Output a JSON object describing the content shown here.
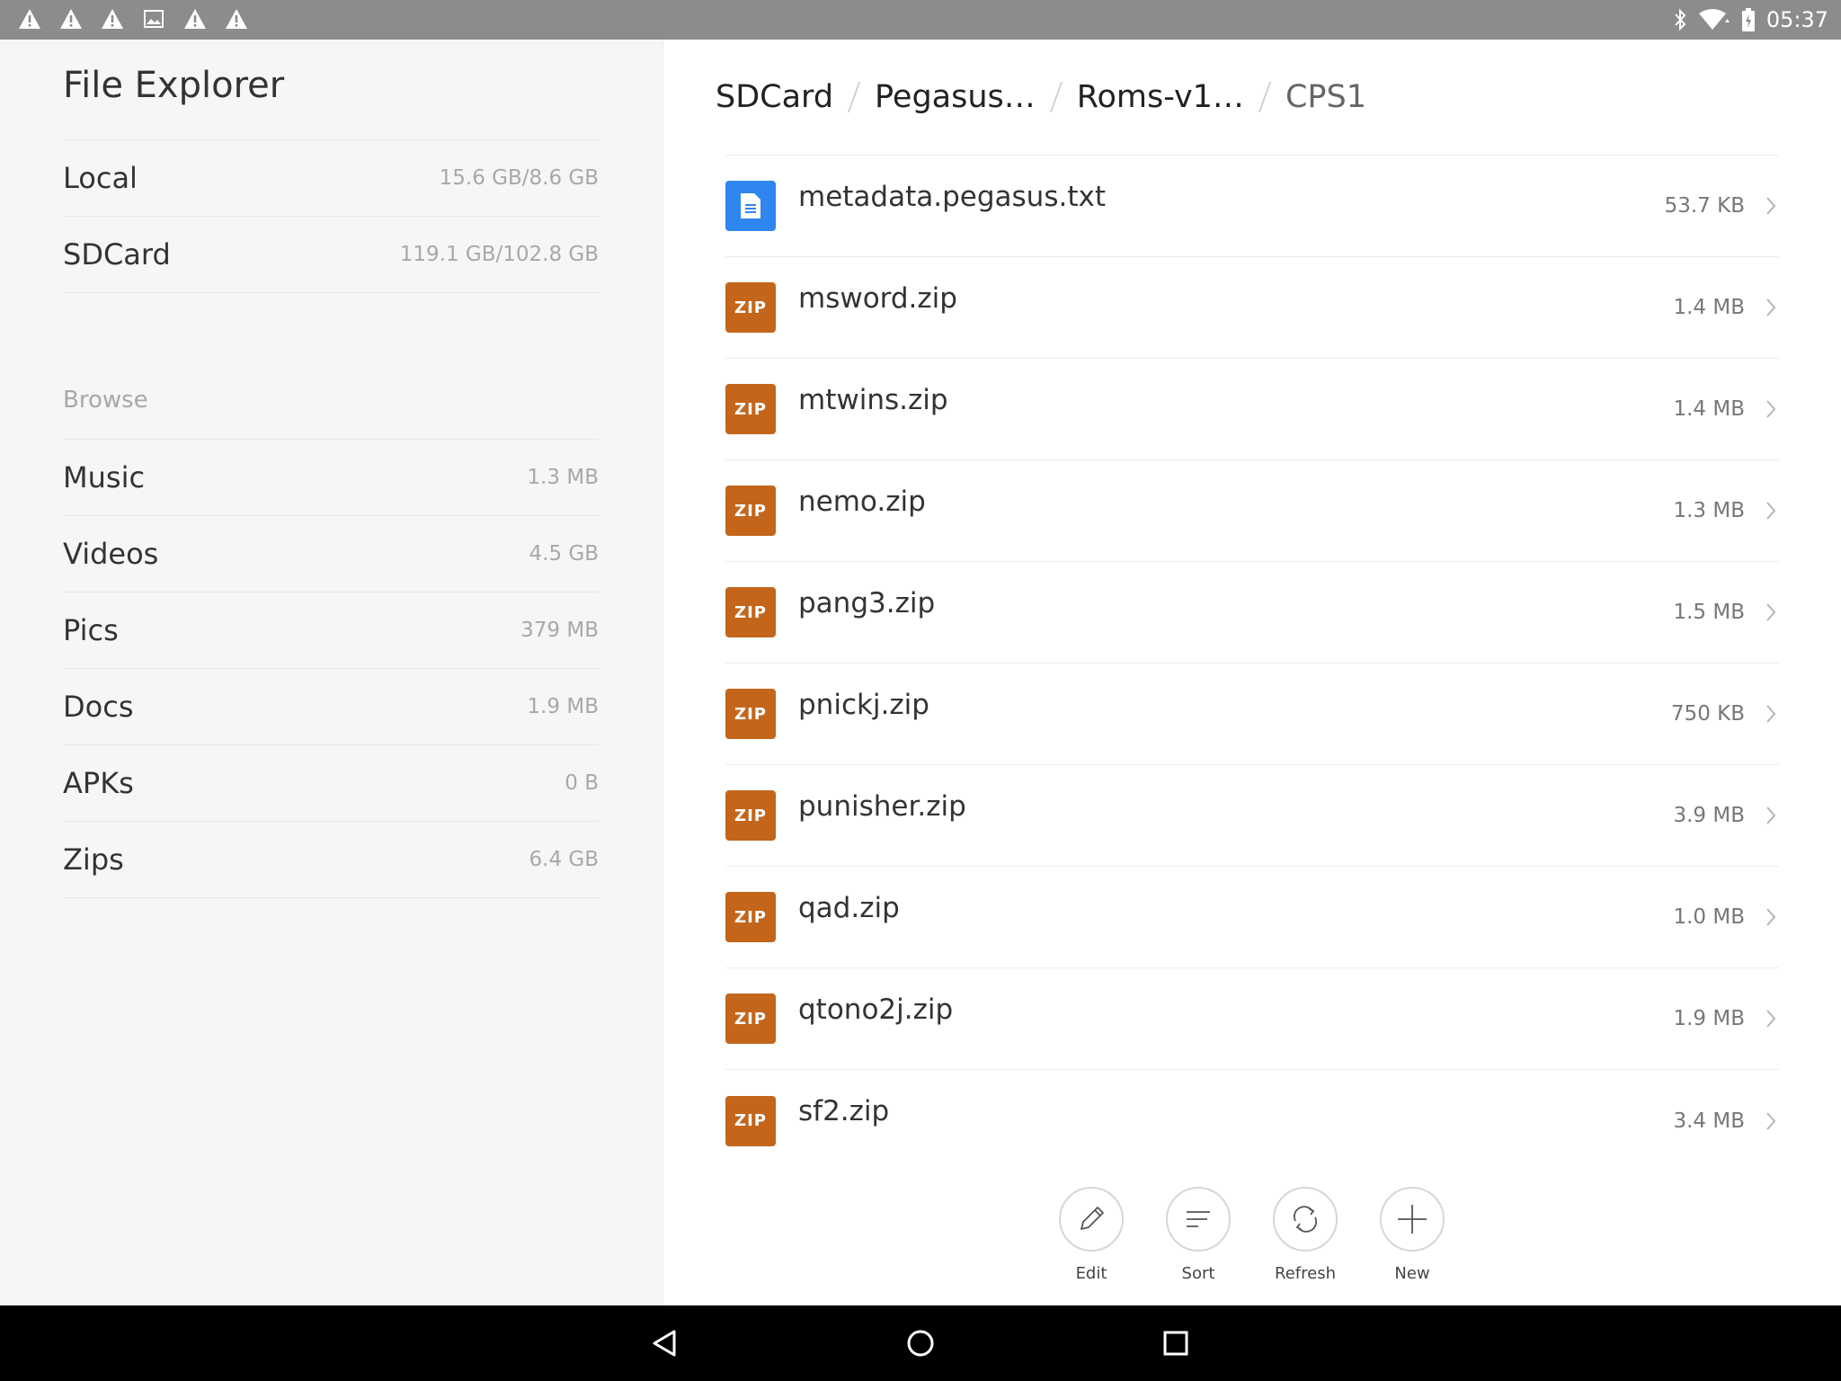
{
  "status_bar": {
    "notification_icons": [
      "warning-icon",
      "warning-icon",
      "warning-icon",
      "image-icon",
      "warning-icon",
      "warning-icon"
    ],
    "time": "05:37",
    "right_icons": [
      "bluetooth-icon",
      "wifi-icon",
      "battery-icon"
    ]
  },
  "sidebar": {
    "title": "File Explorer",
    "storage": [
      {
        "label": "Local",
        "value": "15.6 GB/8.6 GB"
      },
      {
        "label": "SDCard",
        "value": "119.1 GB/102.8 GB"
      }
    ],
    "browse_heading": "Browse",
    "categories": [
      {
        "label": "Music",
        "value": "1.3 MB"
      },
      {
        "label": "Videos",
        "value": "4.5 GB"
      },
      {
        "label": "Pics",
        "value": "379 MB"
      },
      {
        "label": "Docs",
        "value": "1.9 MB"
      },
      {
        "label": "APKs",
        "value": "0 B"
      },
      {
        "label": "Zips",
        "value": "6.4 GB"
      }
    ]
  },
  "breadcrumb": [
    "SDCard",
    "Pegasus…",
    "Roms-v1…",
    "CPS1"
  ],
  "files": [
    {
      "name": "metadata.pegasus.txt",
      "size": "53.7 KB",
      "type": "doc",
      "icon_label": ""
    },
    {
      "name": "msword.zip",
      "size": "1.4 MB",
      "type": "zip",
      "icon_label": "ZIP"
    },
    {
      "name": "mtwins.zip",
      "size": "1.4 MB",
      "type": "zip",
      "icon_label": "ZIP"
    },
    {
      "name": "nemo.zip",
      "size": "1.3 MB",
      "type": "zip",
      "icon_label": "ZIP"
    },
    {
      "name": "pang3.zip",
      "size": "1.5 MB",
      "type": "zip",
      "icon_label": "ZIP"
    },
    {
      "name": "pnickj.zip",
      "size": "750 KB",
      "type": "zip",
      "icon_label": "ZIP"
    },
    {
      "name": "punisher.zip",
      "size": "3.9 MB",
      "type": "zip",
      "icon_label": "ZIP"
    },
    {
      "name": "qad.zip",
      "size": "1.0 MB",
      "type": "zip",
      "icon_label": "ZIP"
    },
    {
      "name": "qtono2j.zip",
      "size": "1.9 MB",
      "type": "zip",
      "icon_label": "ZIP"
    },
    {
      "name": "sf2.zip",
      "size": "3.4 MB",
      "type": "zip",
      "icon_label": "ZIP"
    }
  ],
  "toolbar": {
    "edit_label": "Edit",
    "sort_label": "Sort",
    "refresh_label": "Refresh",
    "new_label": "New"
  },
  "nav_bar": {
    "buttons": [
      "back-icon",
      "home-icon",
      "recents-icon"
    ]
  },
  "colors": {
    "zip_icon": "#c3661c",
    "doc_icon": "#2f86ef",
    "status_bar": "#8c8c8c",
    "sidebar_bg": "#f7f6f6"
  }
}
